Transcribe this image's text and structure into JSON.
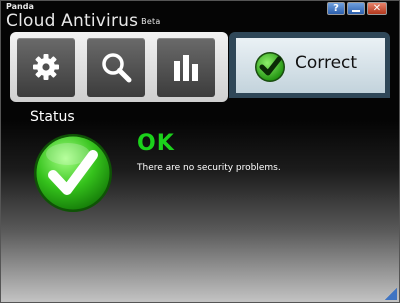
{
  "window": {
    "brand_small": "Panda",
    "brand_name": "Cloud Antivirus",
    "brand_tag": "Beta",
    "controls": {
      "help_icon": "question-mark-icon",
      "minimize_icon": "minimize-icon",
      "close_icon": "close-icon"
    }
  },
  "toolbar": {
    "buttons": [
      {
        "icon": "gear-icon"
      },
      {
        "icon": "magnifier-icon"
      },
      {
        "icon": "bar-chart-icon"
      }
    ],
    "status_tab": {
      "label": "Correct",
      "icon": "check-icon"
    }
  },
  "main": {
    "section_title": "Status",
    "status_word": "OK",
    "status_message": "There are no security problems."
  },
  "colors": {
    "ok_green": "#1bd21b",
    "tab_border": "#2f4758",
    "window_dark": "#050505"
  }
}
